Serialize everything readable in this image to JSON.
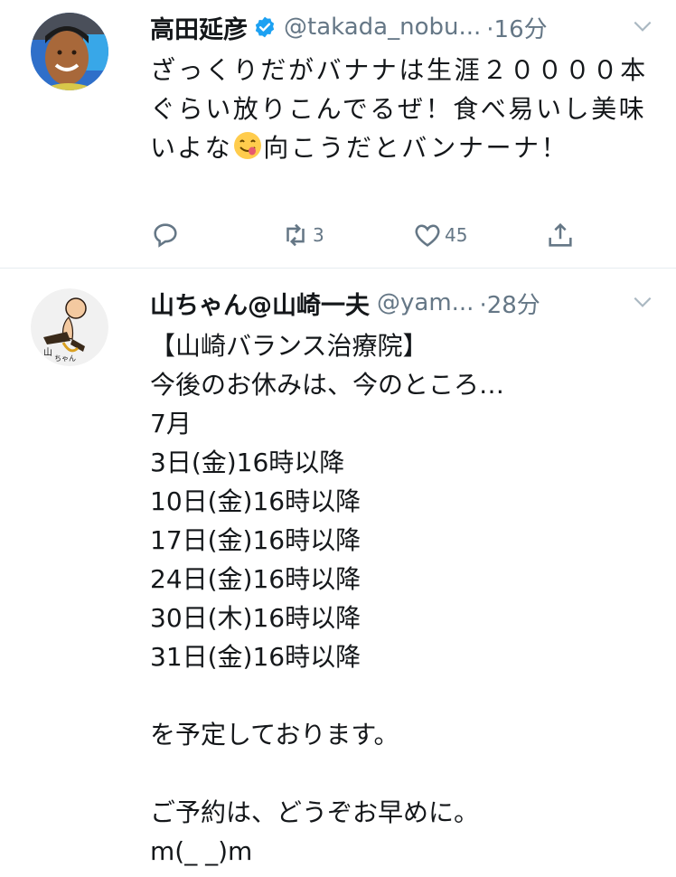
{
  "tweets": [
    {
      "name": "高田延彦",
      "verified": true,
      "handle": "@takada_nobu...",
      "time": "·16分",
      "text_before_emoji": "ざっくりだがバナナは生涯２００００本ぐらい放りこんでるぜ！食べ易いし美味いよな",
      "emoji": "face-savoring-food-emoji",
      "text_after_emoji": "向こうだとバンナーナ！",
      "actions": {
        "reply": "",
        "retweet": "3",
        "like": "45"
      }
    },
    {
      "name": "山ちゃん@山崎一夫",
      "handle": "@yam...",
      "time": "·28分",
      "text": "【山崎バランス治療院】\n今後のお休みは、今のところ…\n7月\n3日(金)16時以降\n10日(金)16時以降\n17日(金)16時以降\n24日(金)16時以降\n30日(木)16時以降\n31日(金)16時以降\n\nを予定しております。\n\nご予約は、どうぞお早めに。\nm(_ _)m"
    }
  ],
  "colors": {
    "verified": "#1da1f2",
    "muted": "#657786",
    "text": "#14171a",
    "divider": "#e6ecf0"
  }
}
